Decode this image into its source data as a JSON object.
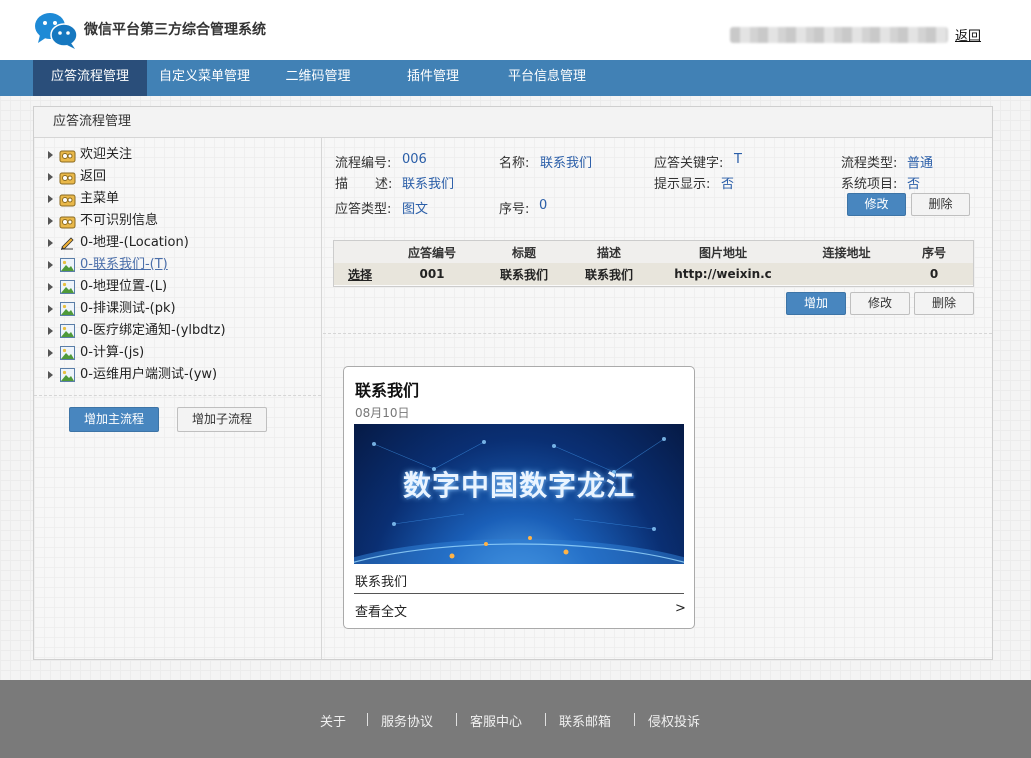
{
  "header": {
    "system_title": "微信平台第三方综合管理系统",
    "back_label": "返回"
  },
  "nav": {
    "items": [
      {
        "label": "应答流程管理",
        "active": true
      },
      {
        "label": "自定义菜单管理",
        "active": false
      },
      {
        "label": "二维码管理",
        "active": false
      },
      {
        "label": "插件管理",
        "active": false
      },
      {
        "label": "平台信息管理",
        "active": false
      }
    ]
  },
  "panel": {
    "title": "应答流程管理"
  },
  "tree": {
    "items": [
      {
        "label": "欢迎关注",
        "icon": "folder-icon"
      },
      {
        "label": "返回",
        "icon": "folder-icon"
      },
      {
        "label": "主菜单",
        "icon": "folder-icon"
      },
      {
        "label": "不可识别信息",
        "icon": "folder-icon"
      },
      {
        "label": "0-地理-(Location)",
        "icon": "edit-icon"
      },
      {
        "label": "0-联系我们-(T)",
        "icon": "image-icon",
        "selected": true
      },
      {
        "label": "0-地理位置-(L)",
        "icon": "image-icon"
      },
      {
        "label": "0-排课测试-(pk)",
        "icon": "image-icon"
      },
      {
        "label": "0-医疗绑定通知-(ylbdtz)",
        "icon": "image-icon"
      },
      {
        "label": "0-计算-(js)",
        "icon": "image-icon"
      },
      {
        "label": "0-运维用户端测试-(yw)",
        "icon": "image-icon"
      }
    ],
    "add_main_label": "增加主流程",
    "add_sub_label": "增加子流程"
  },
  "detail": {
    "flow_no_label": "流程编号:",
    "flow_no": "006",
    "name_label": "名称:",
    "name": "联系我们",
    "keyword_label": "应答关键字:",
    "keyword": "T",
    "flow_type_label": "流程类型:",
    "flow_type": "普通",
    "desc_label_a": "描",
    "desc_label_b": "述:",
    "desc": "联系我们",
    "hint_label": "提示显示:",
    "hint": "否",
    "system_label": "系统项目:",
    "system": "否",
    "answer_type_label": "应答类型:",
    "answer_type": "图文",
    "seq_label": "序号:",
    "seq": "0",
    "edit_label": "修改",
    "delete_label": "删除"
  },
  "table": {
    "columns": [
      "",
      "应答编号",
      "标题",
      "描述",
      "图片地址",
      "连接地址",
      "序号"
    ],
    "rows": [
      {
        "select": "选择",
        "answer_no": "001",
        "title": "联系我们",
        "desc": "联系我们",
        "image_url": "http://weixin.c",
        "link_url": "",
        "seq": "0"
      }
    ],
    "add_label": "增加",
    "edit_label": "修改",
    "delete_label": "删除"
  },
  "card": {
    "title": "联系我们",
    "date": "08月10日",
    "banner_text": "数字中国数字龙江",
    "caption": "联系我们",
    "read_more": "查看全文",
    "chevron": ">"
  },
  "footer": {
    "links": [
      "关于",
      "服务协议",
      "客服中心",
      "联系邮箱",
      "侵权投诉"
    ]
  },
  "colors": {
    "nav_bg": "#4181b5",
    "nav_active": "#2a4e7a",
    "primary_button": "#4886bf",
    "value_text": "#2a5ea8",
    "footer_bg": "#7a7a7a"
  }
}
